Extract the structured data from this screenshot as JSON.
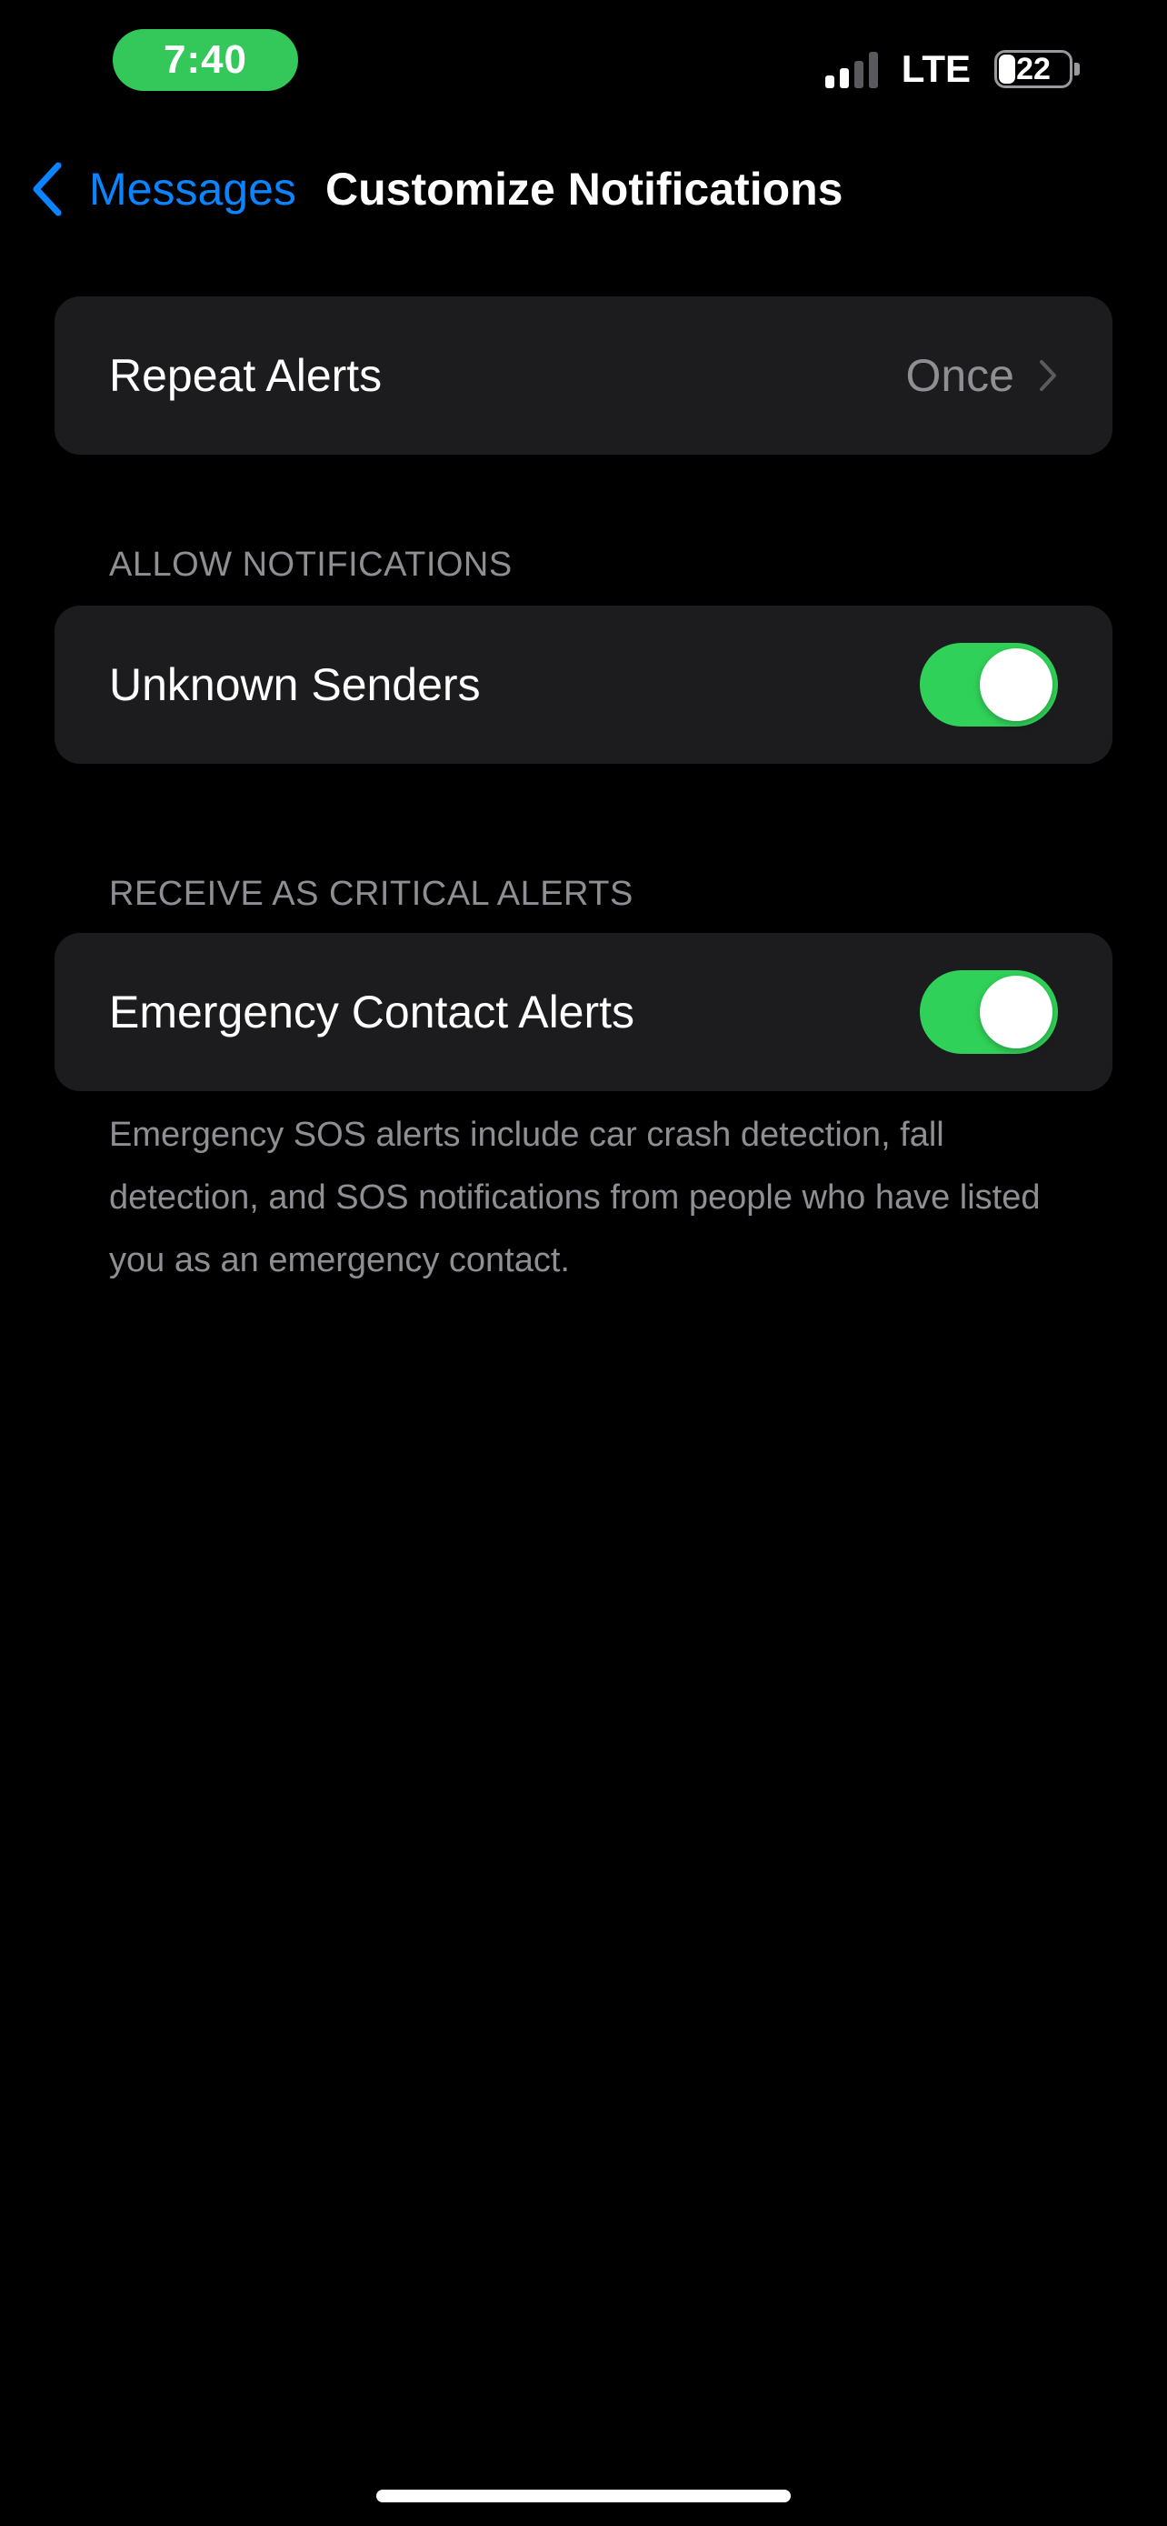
{
  "status_bar": {
    "time": "7:40",
    "network": "LTE",
    "battery_level": "22",
    "battery_fraction": 0.22,
    "signal_bars_total": 4,
    "signal_bars_filled": 2,
    "time_pill_color": "#34C759"
  },
  "nav": {
    "back_label": "Messages",
    "title": "Customize Notifications",
    "back_icon": "chevron-left-icon",
    "accent_color": "#0A84FF"
  },
  "repeat_alerts": {
    "label": "Repeat Alerts",
    "value": "Once",
    "icon": "chevron-right-icon"
  },
  "allow_notifications": {
    "header": "ALLOW NOTIFICATIONS",
    "unknown_senders": {
      "label": "Unknown Senders",
      "enabled": true
    }
  },
  "critical_alerts": {
    "header": "RECEIVE AS CRITICAL ALERTS",
    "emergency_contact": {
      "label": "Emergency Contact Alerts",
      "enabled": true
    },
    "footer": "Emergency SOS alerts include car crash detection, fall detection, and SOS notifications from people who have listed you as an emergency contact."
  },
  "colors": {
    "toggle_on": "#30D158",
    "group_background": "#1C1C1E",
    "secondary_text": "#8E8E93"
  }
}
